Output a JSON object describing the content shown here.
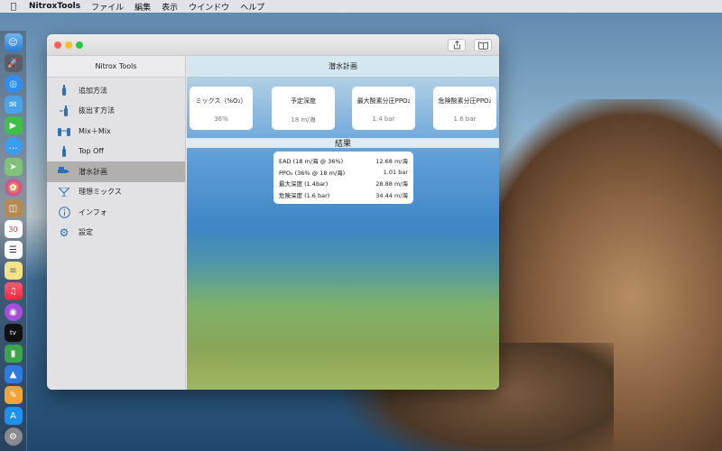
{
  "menubar": {
    "app": "NitroxTools",
    "items": [
      "ファイル",
      "編集",
      "表示",
      "ウインドウ",
      "ヘルプ"
    ]
  },
  "dock": {
    "icons": [
      "finder-icon",
      "launchpad-icon",
      "safari-icon",
      "mail-icon",
      "facetime-icon",
      "messages-icon",
      "maps-icon",
      "photos-icon",
      "contacts-icon",
      "calendar-icon",
      "reminders-icon",
      "notes-icon",
      "music-icon",
      "podcasts-icon",
      "tv-icon",
      "numbers-icon",
      "keynote-icon",
      "pages-icon",
      "app-store-icon",
      "settings-icon"
    ],
    "calendar_day": "30",
    "tv_label": "tv"
  },
  "window": {
    "sidebar_title": "Nitrox Tools",
    "main_title": "潜水計画",
    "sidebar_items": [
      {
        "label": "追加方法",
        "icon": "tank-icon",
        "active": false
      },
      {
        "label": "抜出す方法",
        "icon": "tank-drain-icon",
        "active": false
      },
      {
        "label": "Mix＋Mix",
        "icon": "mix-icon",
        "active": false
      },
      {
        "label": "Top Off",
        "icon": "tank-topoff-icon",
        "active": false
      },
      {
        "label": "潜水計画",
        "icon": "dive-plan-icon",
        "active": true
      },
      {
        "label": "理想ミックス",
        "icon": "ideal-mix-icon",
        "active": false
      },
      {
        "label": "インフォ",
        "icon": "info-icon",
        "active": false
      },
      {
        "label": "設定",
        "icon": "gear-icon",
        "active": false
      }
    ],
    "inputs": [
      {
        "label": "ミックス（%O₂）",
        "value": "36%"
      },
      {
        "label": "予定深度",
        "value": "18 m/海"
      },
      {
        "label": "最大酸素分圧PPO₂",
        "value": "1.4 bar"
      },
      {
        "label": "危険酸素分圧PPO₂",
        "value": "1.6 bar"
      }
    ],
    "results_title": "結果",
    "results": [
      {
        "label": "EAD (18 m/海 @ 36%)",
        "value": "12.68 m/海"
      },
      {
        "label": "PPO₂ (36% @ 18 m/海)",
        "value": "1.01 bar"
      },
      {
        "label": "最大深度 (1.4bar)",
        "value": "28.88 m/海"
      },
      {
        "label": "危険深度 (1.6 bar)",
        "value": "34.44 m/海"
      }
    ]
  }
}
